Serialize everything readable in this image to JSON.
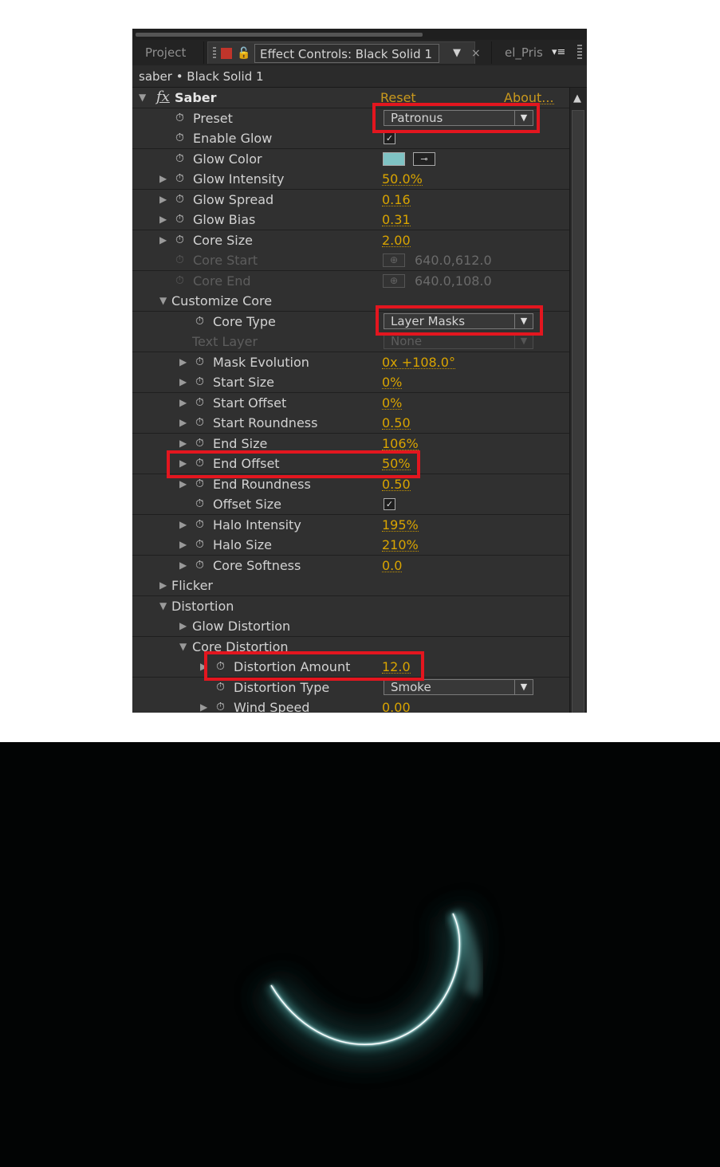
{
  "tabs": {
    "project": "Project",
    "effect_controls": "Effect Controls: Black Solid 1",
    "close": "×",
    "other": "el_Pris",
    "menu_icon": "panel-menu-icon"
  },
  "breadcrumb": "saber • Black Solid 1",
  "effect": {
    "fx_label": "fx",
    "name": "Saber",
    "reset": "Reset",
    "about": "About..."
  },
  "props": {
    "preset": {
      "label": "Preset",
      "value": "Patronus"
    },
    "enable_glow": {
      "label": "Enable Glow",
      "checked": true
    },
    "glow_color": {
      "label": "Glow Color",
      "color": "#7fc3c4"
    },
    "glow_intensity": {
      "label": "Glow Intensity",
      "value": "50.0%"
    },
    "glow_spread": {
      "label": "Glow Spread",
      "value": "0.16"
    },
    "glow_bias": {
      "label": "Glow Bias",
      "value": "0.31"
    },
    "core_size": {
      "label": "Core Size",
      "value": "2.00"
    },
    "core_start": {
      "label": "Core Start",
      "value": "640.0,612.0"
    },
    "core_end": {
      "label": "Core End",
      "value": "640.0,108.0"
    },
    "customize_core": {
      "label": "Customize Core"
    },
    "core_type": {
      "label": "Core Type",
      "value": "Layer Masks"
    },
    "text_layer": {
      "label": "Text Layer",
      "value": "None"
    },
    "mask_evolution": {
      "label": "Mask Evolution",
      "value": "0x +108.0°"
    },
    "start_size": {
      "label": "Start Size",
      "value": "0%"
    },
    "start_offset": {
      "label": "Start Offset",
      "value": "0%"
    },
    "start_roundness": {
      "label": "Start Roundness",
      "value": "0.50"
    },
    "end_size": {
      "label": "End Size",
      "value": "106%"
    },
    "end_offset": {
      "label": "End Offset",
      "value": "50%"
    },
    "end_roundness": {
      "label": "End Roundness",
      "value": "0.50"
    },
    "offset_size": {
      "label": "Offset Size",
      "checked": true
    },
    "halo_intensity": {
      "label": "Halo Intensity",
      "value": "195%"
    },
    "halo_size": {
      "label": "Halo Size",
      "value": "210%"
    },
    "core_softness": {
      "label": "Core Softness",
      "value": "0.0"
    },
    "flicker": {
      "label": "Flicker"
    },
    "distortion": {
      "label": "Distortion"
    },
    "glow_distortion": {
      "label": "Glow Distortion"
    },
    "core_distortion": {
      "label": "Core Distortion"
    },
    "distortion_amount": {
      "label": "Distortion Amount",
      "value": "12.0"
    },
    "distortion_type": {
      "label": "Distortion Type",
      "value": "Smoke"
    },
    "wind_speed": {
      "label": "Wind Speed",
      "value": "0.00"
    }
  },
  "glyphs": {
    "stopwatch": "⏱",
    "tri_right": "▶",
    "tri_down": "▼",
    "check": "✓",
    "caret": "▼",
    "up": "▲"
  },
  "colors": {
    "highlight": "#e3161f",
    "value_orange": "#d9a400",
    "glow": "#7fc3c4"
  }
}
